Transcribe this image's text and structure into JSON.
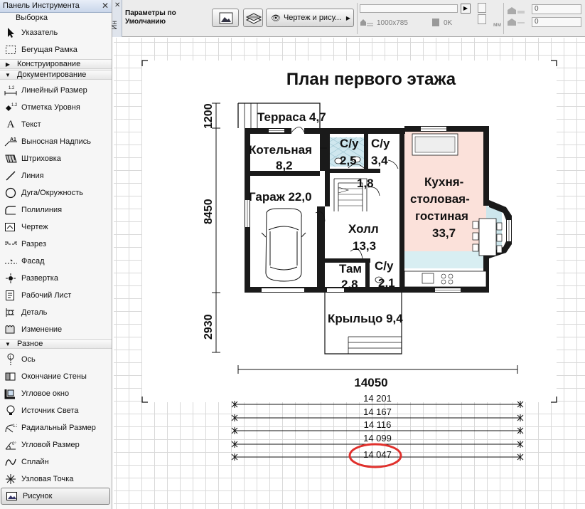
{
  "toolbox": {
    "title": "Панель Инструмента",
    "close": "✕",
    "select_label": "Выборка",
    "items": [
      {
        "label": "Указатель",
        "icon": "pointer-icon"
      },
      {
        "label": "Бегущая Рамка",
        "icon": "marquee-icon"
      }
    ],
    "sections": {
      "construction": "Конструирование",
      "documentation": "Документирование",
      "misc": "Разное"
    },
    "doc_items": [
      {
        "label": "Линейный Размер",
        "icon": "linear-dimension-icon"
      },
      {
        "label": "Отметка Уровня",
        "icon": "level-dimension-icon"
      },
      {
        "label": "Текст",
        "icon": "text-icon"
      },
      {
        "label": "Выносная Надпись",
        "icon": "label-icon"
      },
      {
        "label": "Штриховка",
        "icon": "fill-icon"
      },
      {
        "label": "Линия",
        "icon": "line-icon"
      },
      {
        "label": "Дуга/Окружность",
        "icon": "arc-circle-icon"
      },
      {
        "label": "Полилиния",
        "icon": "polyline-icon"
      },
      {
        "label": "Чертеж",
        "icon": "drawing-icon"
      },
      {
        "label": "Разрез",
        "icon": "section-icon"
      },
      {
        "label": "Фасад",
        "icon": "elevation-icon"
      },
      {
        "label": "Развертка",
        "icon": "interior-elevation-icon"
      },
      {
        "label": "Рабочий Лист",
        "icon": "worksheet-icon"
      },
      {
        "label": "Деталь",
        "icon": "detail-icon"
      },
      {
        "label": "Изменение",
        "icon": "change-icon"
      }
    ],
    "misc_items": [
      {
        "label": "Ось",
        "icon": "grid-axis-icon"
      },
      {
        "label": "Окончание Стены",
        "icon": "wall-end-icon"
      },
      {
        "label": "Угловое окно",
        "icon": "corner-window-icon"
      },
      {
        "label": "Источник Света",
        "icon": "lamp-icon"
      },
      {
        "label": "Радиальный Размер",
        "icon": "radial-dimension-icon"
      },
      {
        "label": "Угловой Размер",
        "icon": "angle-dimension-icon"
      },
      {
        "label": "Сплайн",
        "icon": "spline-icon"
      },
      {
        "label": "Узловая Точка",
        "icon": "hotspot-icon"
      },
      {
        "label": "Рисунок",
        "icon": "figure-icon"
      }
    ]
  },
  "vstrip": {
    "label": "Ин",
    "close": "✕"
  },
  "infobox": {
    "param_line1": "Параметры по",
    "param_line2": "Умолчанию",
    "view_label": "Чертеж и рису...",
    "resolution": "1000x785",
    "size": "0K",
    "unit": "мм",
    "field1": "0",
    "field2": "0"
  },
  "plan": {
    "title": "План первого этажа",
    "rooms": {
      "terrace": "Терраса 4,7",
      "boiler_1": "Котельная",
      "boiler_2": "8,2",
      "bath1_1": "С/у",
      "bath1_2": "2,5",
      "bath2_1": "С/у",
      "bath2_2": "3,4",
      "stair": "1,8",
      "garage": "Гараж 22,0",
      "kitchen_1": "Кухня-",
      "kitchen_2": "столовая-",
      "kitchen_3": "гостиная",
      "kitchen_4": "33,7",
      "hall_1": "Холл",
      "hall_2": "13,3",
      "tam_1": "Там",
      "tam_2": "2,8",
      "bath3_1": "С/у",
      "bath3_2": "2,1",
      "porch": "Крыльцо 9,4"
    },
    "dims": {
      "d1200": "1200",
      "d8450": "8450",
      "d2930": "2930",
      "d14050": "14050"
    }
  },
  "dimension_lines": [
    "14 201",
    "14 167",
    "14 116",
    "14 099",
    "14 047"
  ],
  "highlight_color": "#e0302c"
}
